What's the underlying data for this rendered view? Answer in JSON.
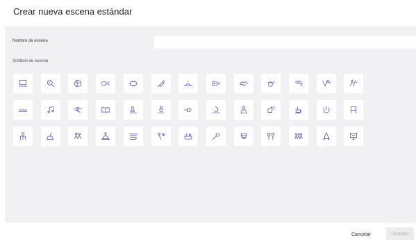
{
  "dialog": {
    "title": "Crear nueva escena estándar",
    "name_label": "Nombre de escena",
    "name_value": "",
    "name_placeholder": "",
    "symbol_label": "Símbolo de escena",
    "cancel_label": "Cancelar",
    "save_label": "Guardar"
  },
  "colors": {
    "panel_bg": "#f1f1f4",
    "icon": "#3a3f9a",
    "save_disabled_bg": "#ececee",
    "save_disabled_text": "#b5b5b5"
  },
  "symbols": [
    [
      "laptop-icon",
      "magnifier-icon",
      "ball-icon",
      "projector-icon",
      "table-icon",
      "syringe-icon",
      "sunrise-icon",
      "camera-icon",
      "handshake-icon",
      "watering-can-icon",
      "group-icon",
      "pipette-icon",
      "hands-icon"
    ],
    [
      "bed-icon",
      "music-note-icon",
      "eye-icon",
      "book-icon",
      "cooking-icon",
      "meditation-icon",
      "plug-icon",
      "moon-icon",
      "reading-icon",
      "megaphone-icon",
      "coffee-cup-icon",
      "power-icon",
      "chair-icon"
    ],
    [
      "person-icon",
      "broom-icon",
      "people-icon",
      "picnic-icon",
      "shower-icon",
      "sprinkler-icon",
      "bath-icon",
      "wrench-icon",
      "masks-icon",
      "glasses-icon",
      "family-icon",
      "rocket-icon",
      "monitor-icon"
    ]
  ]
}
